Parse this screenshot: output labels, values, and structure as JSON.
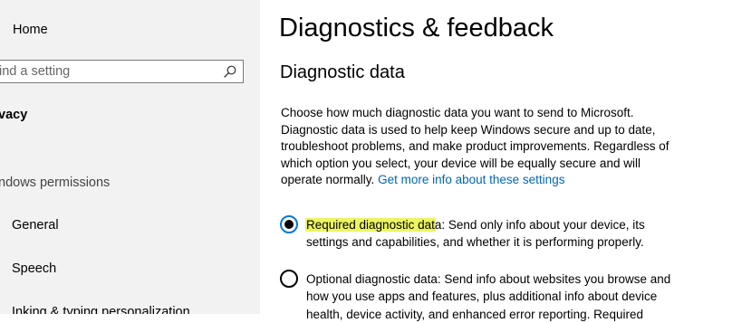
{
  "sidebar": {
    "home_label": "Home",
    "search_placeholder": "ind a setting",
    "section_heading": "vacy",
    "group_label": "ndows permissions",
    "items": [
      {
        "label": "General"
      },
      {
        "label": "Speech"
      },
      {
        "label": "Inking & typing personalization"
      }
    ]
  },
  "main": {
    "page_title": "Diagnostics & feedback",
    "section_title": "Diagnostic data",
    "description": {
      "lines": [
        "Choose how much diagnostic data you want to send to Microsoft.",
        "Diagnostic data is used to help keep Windows secure and up to date,",
        "troubleshoot problems, and make product improvements. Regardless of",
        "which option you select, your device will be equally secure and will",
        "operate normally."
      ],
      "link_text": "Get more info about these settings"
    },
    "options": [
      {
        "highlighted_text": "Required diagnostic dat",
        "line1_rest": "a: Send only info about your device, its",
        "line2": "settings and capabilities, and whether it is performing properly.",
        "selected": true
      },
      {
        "line1": "Optional diagnostic data: Send info about websites you browse and",
        "line2": "how you use apps and features, plus additional info about device",
        "line3": "health, device activity, and enhanced error reporting. Required",
        "selected": false
      }
    ]
  },
  "colors": {
    "sidebar_bg": "#f2f2f2",
    "link": "#0066b4",
    "radio_accent": "#0078d7",
    "highlight": "#ecf560"
  }
}
